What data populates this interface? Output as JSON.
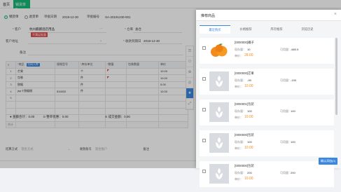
{
  "topbar": {
    "home": "首页",
    "active_tab": "销货单"
  },
  "form": {
    "radio_sale": "销货单",
    "radio_return": "退货单",
    "date_label": "单据日期",
    "date_value": "2019-12-30",
    "number_label": "单据编号",
    "number_value": "SA-20191230-001",
    "customer_label": "客户",
    "customer_value": "杭州麒麟酒店用品",
    "customer_tag": "不满足批量",
    "warehouse_label": "仓库",
    "warehouse_value": "总仓",
    "address_label": "客户地址",
    "delivery_label": "收款到期日",
    "delivery_value": "2019-12-30",
    "remark_label": "备注"
  },
  "table": {
    "headers": [
      "",
      "商品",
      "规格型号",
      "库存单位",
      "数量",
      "包装数量",
      "单价"
    ],
    "goods_button": "扫码入库",
    "rows": [
      {
        "no": "1",
        "name": "芒果",
        "spec": "",
        "unit": "个",
        "qty": "",
        "pack": "",
        "price": "10.00"
      },
      {
        "no": "2",
        "name": "包装",
        "spec": "",
        "unit": "件",
        "qty": "",
        "pack": "",
        "price": "10.00"
      },
      {
        "no": "3",
        "name": "猕猴",
        "spec": "",
        "unit": "件",
        "qty": "",
        "pack": "",
        "price": "5.00"
      },
      {
        "no": "4",
        "name": "jsp十猕猴桃",
        "spec": "534532",
        "unit": "件",
        "qty": "",
        "pack": "",
        "price": "10.00"
      },
      {
        "no": "5",
        "name": "",
        "spec": "",
        "unit": "",
        "qty": "",
        "pack": "",
        "price": ""
      }
    ],
    "sum_label": "合计"
  },
  "totals": {
    "amount_label": "金额合计：",
    "amount_value": "0.00",
    "discount_label": "整单优惠：",
    "discount_value": "0.00",
    "deal_label": "成交金额：",
    "deal_value": "0.00"
  },
  "footer": {
    "pay_label": "结算方式",
    "pay_placeholder": "现金方式",
    "account_label": "收款账号",
    "account_placeholder": "现金账户",
    "extra": "备注"
  },
  "panel": {
    "title": "推荐商品",
    "tabs": [
      "最近购买",
      "价格推荐",
      "库存推荐",
      "浏览历史"
    ],
    "items": [
      {
        "name": "[0000000]橘子",
        "stock_label": "现存量：",
        "stock": "10",
        "avail_label": "可用量：",
        "avail": "-680.5",
        "price_label": "单价：",
        "price": "28.00",
        "thumb": "orange"
      },
      {
        "name": "[0000000]芒果",
        "stock_label": "现存量：",
        "stock": "-99",
        "avail_label": "可用量：",
        "avail": "-190",
        "price_label": "单价：",
        "price": "10.00",
        "thumb": "placeholder"
      },
      {
        "name": "[0000001]包装",
        "stock_label": "现存量：",
        "stock": "100",
        "avail_label": "可用量：",
        "avail": "100",
        "price_label": "单价：",
        "price": "10.00",
        "thumb": "placeholder"
      },
      {
        "name": "[0000000]包装",
        "stock_label": "现存量：",
        "stock": "100",
        "avail_label": "可用量：",
        "avail": "100",
        "price_label": "单价：",
        "price": "10.00",
        "thumb": "placeholder"
      },
      {
        "name": "[0000000]包装",
        "stock_label": "现存量：",
        "stock": "200",
        "avail_label": "可用量：",
        "avail": "200",
        "price_label": "单价：",
        "price": "10.00",
        "thumb": "placeholder"
      }
    ],
    "confirm": "确认添加(0)"
  },
  "colors": {
    "accent": "#17b978",
    "blue": "#3a87e0",
    "price": "#f08a24",
    "danger": "#e14b4b"
  }
}
